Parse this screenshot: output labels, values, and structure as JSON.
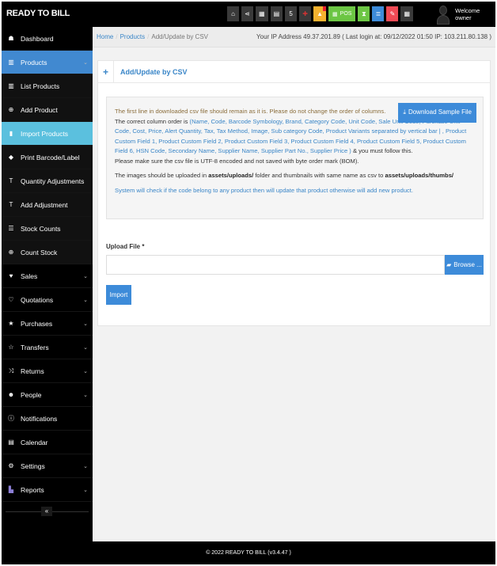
{
  "app": {
    "brand": "READY TO BILL"
  },
  "topbar": {
    "icons": [
      {
        "name": "home-icon",
        "glyph": "⌂"
      },
      {
        "name": "share-icon",
        "glyph": "⋖"
      },
      {
        "name": "calculator-icon",
        "glyph": "▦"
      },
      {
        "name": "calendar-icon",
        "glyph": "▤"
      },
      {
        "name": "html5-icon",
        "glyph": "5"
      },
      {
        "name": "language-flag-icon",
        "glyph": "✚"
      },
      {
        "name": "alert-icon",
        "glyph": "▲"
      },
      {
        "name": "pos-icon",
        "glyph": "▦",
        "label": "POS"
      },
      {
        "name": "hourglass-icon",
        "glyph": "⧗"
      },
      {
        "name": "list-icon",
        "glyph": "≣"
      },
      {
        "name": "eraser-icon",
        "glyph": "✎"
      },
      {
        "name": "grid-icon",
        "glyph": "▦"
      }
    ],
    "welcome": "Welcome owner"
  },
  "sidebar": {
    "items": [
      {
        "label": "Dashboard",
        "icon": "dashboard-icon",
        "glyph": "☗"
      },
      {
        "label": "Products",
        "icon": "barcode-icon",
        "glyph": "▥",
        "chevron": "⌄"
      },
      {
        "label": "List Products",
        "icon": "barcode-icon",
        "glyph": "▥"
      },
      {
        "label": "Add Product",
        "icon": "plus-circle-icon",
        "glyph": "⊕"
      },
      {
        "label": "Import Products",
        "icon": "file-icon",
        "glyph": "▮"
      },
      {
        "label": "Print Barcode/Label",
        "icon": "tag-icon",
        "glyph": "◆"
      },
      {
        "label": "Quantity Adjustments",
        "icon": "filter-icon",
        "glyph": "T"
      },
      {
        "label": "Add Adjustment",
        "icon": "filter-icon",
        "glyph": "T"
      },
      {
        "label": "Stock Counts",
        "icon": "list-ol-icon",
        "glyph": "☰"
      },
      {
        "label": "Count Stock",
        "icon": "plus-circle-icon",
        "glyph": "⊕"
      },
      {
        "label": "Sales",
        "icon": "heart-icon",
        "glyph": "♥",
        "chevron": "⌄"
      },
      {
        "label": "Quotations",
        "icon": "heart-outline-icon",
        "glyph": "♡",
        "chevron": "⌄"
      },
      {
        "label": "Purchases",
        "icon": "star-icon",
        "glyph": "★",
        "chevron": "⌄"
      },
      {
        "label": "Transfers",
        "icon": "star-outline-icon",
        "glyph": "☆",
        "chevron": "⌄"
      },
      {
        "label": "Returns",
        "icon": "random-icon",
        "glyph": "⤨",
        "chevron": "⌄"
      },
      {
        "label": "People",
        "icon": "users-icon",
        "glyph": "☻",
        "chevron": "⌄"
      },
      {
        "label": "Notifications",
        "icon": "info-circle-icon",
        "glyph": "ⓘ"
      },
      {
        "label": "Calendar",
        "icon": "calendar-icon",
        "glyph": "▤"
      },
      {
        "label": "Settings",
        "icon": "cog-icon",
        "glyph": "⚙",
        "chevron": "⌄"
      },
      {
        "label": "Reports",
        "icon": "bar-chart-icon",
        "glyph": "▙",
        "chevron": "⌄"
      }
    ],
    "collapse_glyph": "«"
  },
  "breadcrumb": {
    "home": "Home",
    "products": "Products",
    "current": "Add/Update by CSV"
  },
  "ip_info": "Your IP Address 49.37.201.89 ( Last login at: 09/12/2022 01:50 IP: 103.211.80.138 )",
  "panel": {
    "plus": "+",
    "title": "Add/Update by CSV",
    "download_button": "Download Sample File",
    "notes": {
      "line1": "The first line in downloaded csv file should remain as it is. Please do not change the order of columns.",
      "line2_prefix": "The correct column order is ",
      "line2_columns": "(Name, Code, Barcode Symbology, Brand, Category Code, Unit Code, Sale Unit Code, Purchase Unit Code, Cost, Price, Alert Quantity, Tax, Tax Method, Image, Sub category Code, Product Variants separated by vertical bar | , Product Custom Field 1, Product Custom Field 2, Product Custom Field 3, Product Custom Field 4, Product Custom Field 5, Product Custom Field 6, HSN Code, Secondary Name, Supplier Name, Supplier Part No., Supplier Price )",
      "line2_suffix": " & you must follow this.",
      "line3": "Please make sure the csv file is UTF-8 encoded and not saved with byte order mark (BOM).",
      "line4_prefix": "The images should be uploaded in ",
      "line4_path1": "assets/uploads/",
      "line4_mid": " folder and thumbnails with same name as csv to ",
      "line4_path2": "assets/uploads/thumbs/",
      "line5": "System will check if the code belong to any product then will update that product otherwise will add new product."
    },
    "upload_label": "Upload File *",
    "upload_value": "",
    "browse_button": "Browse ...",
    "import_button": "Import"
  },
  "footer": "© 2022 READY TO BILL (v3.4.47 )"
}
